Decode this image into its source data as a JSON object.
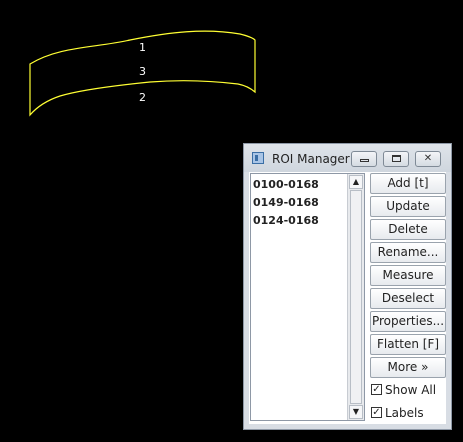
{
  "canvas": {
    "roi_labels": [
      "1",
      "3",
      "2"
    ],
    "roi_color": "#ffff33"
  },
  "roi_manager": {
    "title": "ROI Manager",
    "icon": "imagej-icon",
    "window_controls": [
      "minimize-icon",
      "maximize-icon",
      "close-icon"
    ],
    "items": [
      "0100-0168",
      "0149-0168",
      "0124-0168"
    ],
    "buttons": {
      "add": "Add [t]",
      "update": "Update",
      "delete": "Delete",
      "rename": "Rename...",
      "measure": "Measure",
      "deselect": "Deselect",
      "properties": "Properties...",
      "flatten": "Flatten [F]",
      "more": "More »"
    },
    "checkboxes": {
      "show_all": {
        "label": "Show All",
        "checked": true
      },
      "labels": {
        "label": "Labels",
        "checked": true
      }
    }
  }
}
